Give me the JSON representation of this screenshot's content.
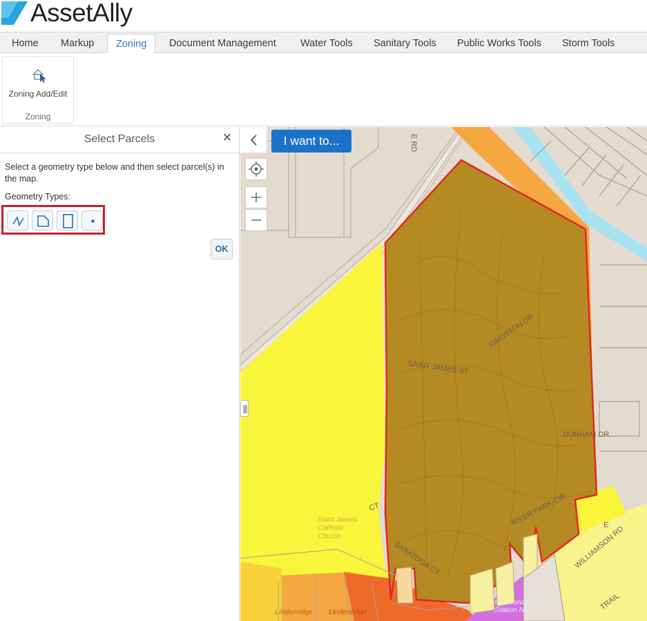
{
  "app": {
    "name": "AssetAlly"
  },
  "tabs": [
    {
      "label": "Home",
      "active": false
    },
    {
      "label": "Markup",
      "active": false
    },
    {
      "label": "Zoning",
      "active": true
    },
    {
      "label": "Document Management",
      "active": false
    },
    {
      "label": "Water Tools",
      "active": false
    },
    {
      "label": "Sanitary Tools",
      "active": false
    },
    {
      "label": "Public Works Tools",
      "active": false
    },
    {
      "label": "Storm Tools",
      "active": false
    }
  ],
  "ribbon": {
    "button_label": "Zoning Add/Edit",
    "button_icon": "zoning-edit-icon",
    "group_label": "Zoning"
  },
  "panel": {
    "title": "Select Parcels",
    "instructions": "Select a geometry type below and then select parcel(s) in the map.",
    "geometry_label": "Geometry Types:",
    "geometry_types": [
      {
        "icon": "polyline-icon"
      },
      {
        "icon": "polygon-icon"
      },
      {
        "icon": "rectangle-icon"
      },
      {
        "icon": "point-icon"
      }
    ],
    "ok_label": "OK"
  },
  "map": {
    "i_want_to_label": "I want to...",
    "street_labels": {
      "top_road": "E RD",
      "saint_james": "SAINT JAMES ST",
      "kingston": "KINGSTON DR",
      "durham": "DURHAM DR",
      "river_park": "RIVER PARK CIR",
      "rd_x": "SARATOGA CT",
      "ct": "CT",
      "east": "E",
      "wilkinson": "WILLIAMSON RD",
      "trail": "TRAIL"
    },
    "place_labels": {
      "church": "Saint James Catholic Church",
      "lindenridge": "Lindenridge",
      "lindencourt": "Lindencourt",
      "fire_station": "Mukwonago Fire Station Num 1"
    },
    "colors": {
      "accent": "#1a73c9",
      "highlight_border": "#c8202b",
      "zone_yellow": "#f8f53b",
      "zone_orange": "#f5a742",
      "zone_brown": "#b58a22",
      "zone_red": "#e8321f",
      "zone_purple": "#d46fe0",
      "water": "#a7e3f0",
      "base": "#e3dbd0"
    }
  }
}
